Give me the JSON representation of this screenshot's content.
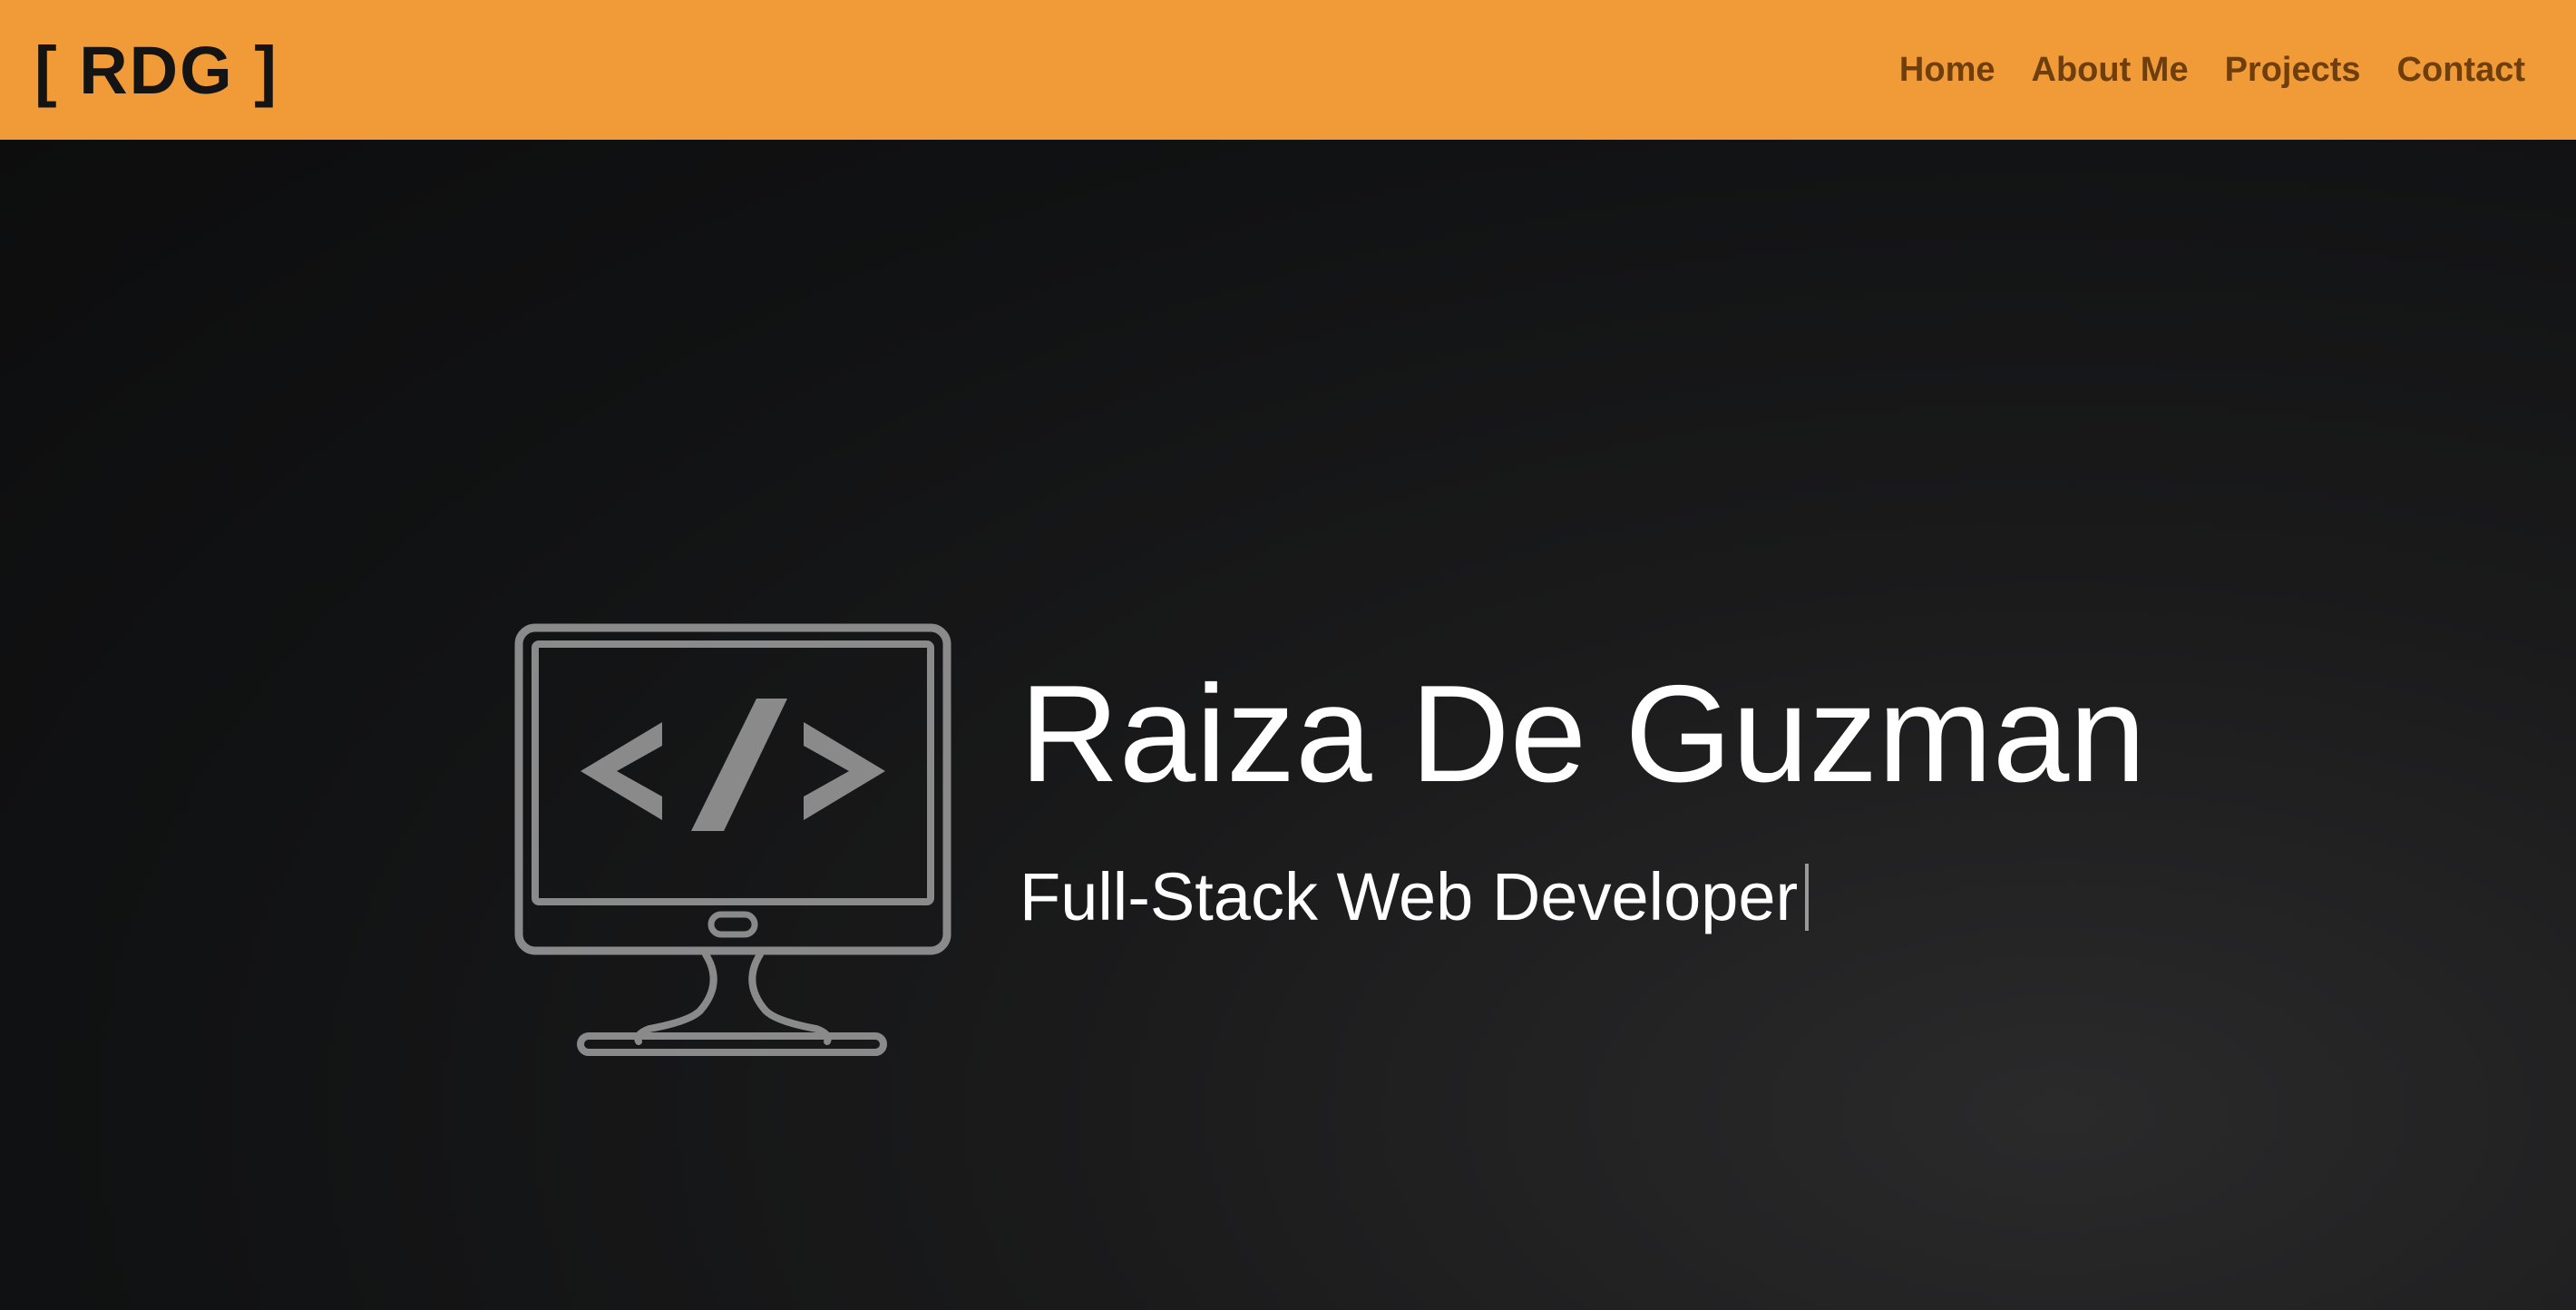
{
  "navbar": {
    "brand": "[ RDG ]",
    "links": [
      {
        "label": "Home"
      },
      {
        "label": "About Me"
      },
      {
        "label": "Projects"
      },
      {
        "label": "Contact"
      }
    ]
  },
  "hero": {
    "icon": "monitor-code-icon",
    "name": "Raiza De Guzman",
    "role": "Full-Stack Web Developer"
  },
  "colors": {
    "navbar_bg": "#f09a38",
    "brand_text": "#141414",
    "nav_link": "#6e3f0d",
    "hero_bg": "#111213",
    "hero_text": "#ffffff",
    "icon_stroke": "#8a8a8a"
  }
}
